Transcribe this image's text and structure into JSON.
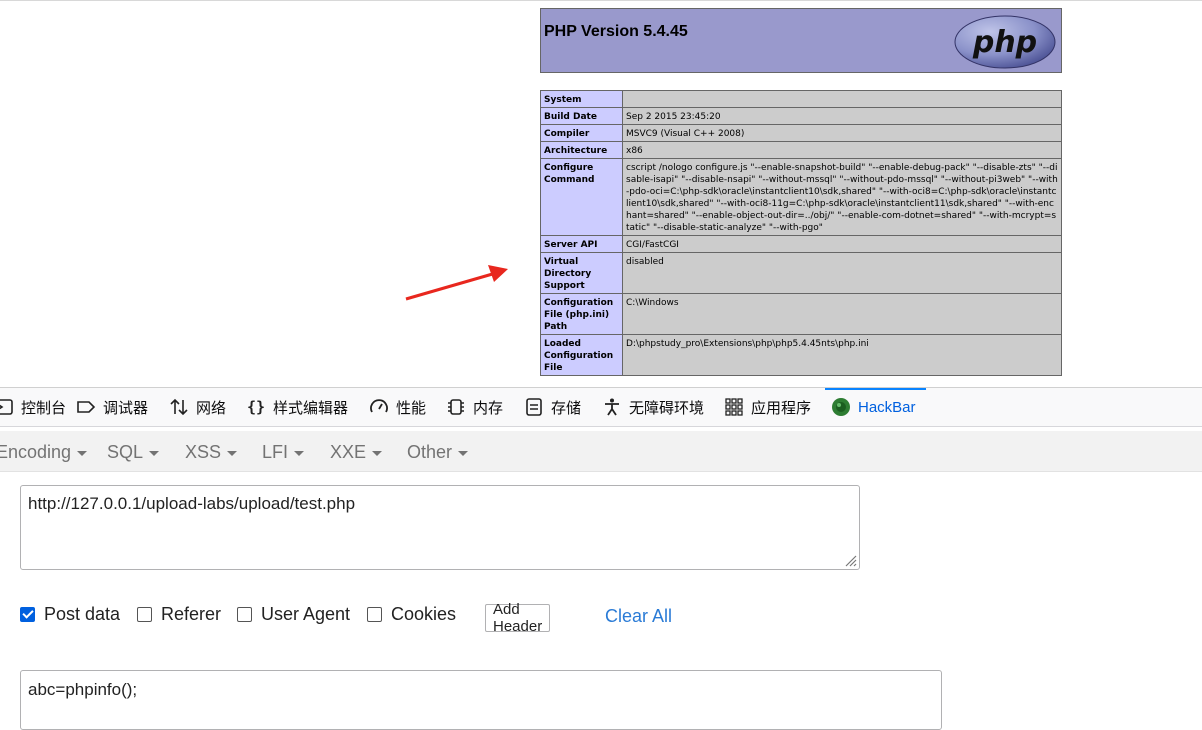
{
  "phpinfo": {
    "version_title": "PHP Version 5.4.45",
    "logo_text": "php",
    "rows": [
      {
        "label": "System",
        "value": ""
      },
      {
        "label": "Build Date",
        "value": "Sep 2 2015 23:45:20"
      },
      {
        "label": "Compiler",
        "value": "MSVC9 (Visual C++ 2008)"
      },
      {
        "label": "Architecture",
        "value": "x86"
      },
      {
        "label": "Configure Command",
        "value": "cscript /nologo configure.js \"--enable-snapshot-build\" \"--enable-debug-pack\" \"--disable-zts\" \"--disable-isapi\" \"--disable-nsapi\" \"--without-mssql\" \"--without-pdo-mssql\" \"--without-pi3web\" \"--with-pdo-oci=C:\\php-sdk\\oracle\\instantclient10\\sdk,shared\" \"--with-oci8=C:\\php-sdk\\oracle\\instantclient10\\sdk,shared\" \"--with-oci8-11g=C:\\php-sdk\\oracle\\instantclient11\\sdk,shared\" \"--with-enchant=shared\" \"--enable-object-out-dir=../obj/\" \"--enable-com-dotnet=shared\" \"--with-mcrypt=static\" \"--disable-static-analyze\" \"--with-pgo\""
      },
      {
        "label": "Server API",
        "value": "CGI/FastCGI"
      },
      {
        "label": "Virtual Directory Support",
        "value": "disabled"
      },
      {
        "label": "Configuration File (php.ini) Path",
        "value": "C:\\Windows"
      },
      {
        "label": "Loaded Configuration File",
        "value": "D:\\phpstudy_pro\\Extensions\\php\\php5.4.45nts\\php.ini"
      }
    ]
  },
  "devtools": {
    "tabs": [
      {
        "label": "控制台",
        "icon": "console-icon"
      },
      {
        "label": "调试器",
        "icon": "debugger-icon"
      },
      {
        "label": "网络",
        "icon": "network-icon"
      },
      {
        "label": "样式编辑器",
        "icon": "style-editor-icon"
      },
      {
        "label": "性能",
        "icon": "performance-icon"
      },
      {
        "label": "内存",
        "icon": "memory-icon"
      },
      {
        "label": "存储",
        "icon": "storage-icon"
      },
      {
        "label": "无障碍环境",
        "icon": "accessibility-icon"
      },
      {
        "label": "应用程序",
        "icon": "application-icon"
      },
      {
        "label": "HackBar",
        "icon": "hackbar-icon",
        "active": true
      }
    ]
  },
  "hackbar": {
    "menus": [
      "Encoding",
      "SQL",
      "XSS",
      "LFI",
      "XXE",
      "Other"
    ],
    "url_value": "http://127.0.0.1/upload-labs/upload/test.php",
    "options": {
      "post_data": {
        "label": "Post data",
        "checked": true
      },
      "referer": {
        "label": "Referer",
        "checked": false
      },
      "user_agent": {
        "label": "User Agent",
        "checked": false
      },
      "cookies": {
        "label": "Cookies",
        "checked": false
      }
    },
    "add_header_label": "Add Header",
    "clear_all_label": "Clear All",
    "post_body_value": "abc=phpinfo();"
  },
  "colors": {
    "php_header_bg": "#9999cc",
    "php_label_bg": "#ccccff",
    "php_value_bg": "#cccccc",
    "accent_blue": "#0060df",
    "annotation_arrow": "#e8271e"
  }
}
